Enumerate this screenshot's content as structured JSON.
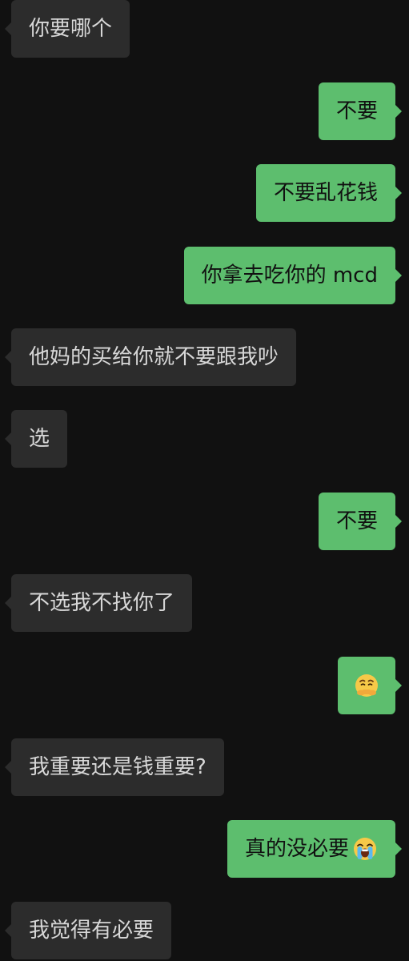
{
  "messages": [
    {
      "side": "in",
      "text": "你要哪个"
    },
    {
      "side": "out",
      "text": "不要"
    },
    {
      "side": "out",
      "text": "不要乱花钱"
    },
    {
      "side": "out",
      "text": "你拿去吃你的 mcd"
    },
    {
      "side": "in",
      "text": "他妈的买给你就不要跟我吵"
    },
    {
      "side": "in",
      "text": "选"
    },
    {
      "side": "out",
      "text": "不要"
    },
    {
      "side": "in",
      "text": "不选我不找你了"
    },
    {
      "side": "out",
      "text": "",
      "emoji": "worried-face-covering-mouth-icon"
    },
    {
      "side": "in",
      "text": "我重要还是钱重要?"
    },
    {
      "side": "out",
      "text": "真的没必要",
      "emoji": "loudly-crying-face-icon"
    },
    {
      "side": "in",
      "text": "我觉得有必要"
    }
  ],
  "colors": {
    "background": "#111111",
    "incoming_bubble": "#2c2c2c",
    "incoming_text": "#d8d8d8",
    "outgoing_bubble": "#5dbe6e",
    "outgoing_text": "#111111"
  }
}
